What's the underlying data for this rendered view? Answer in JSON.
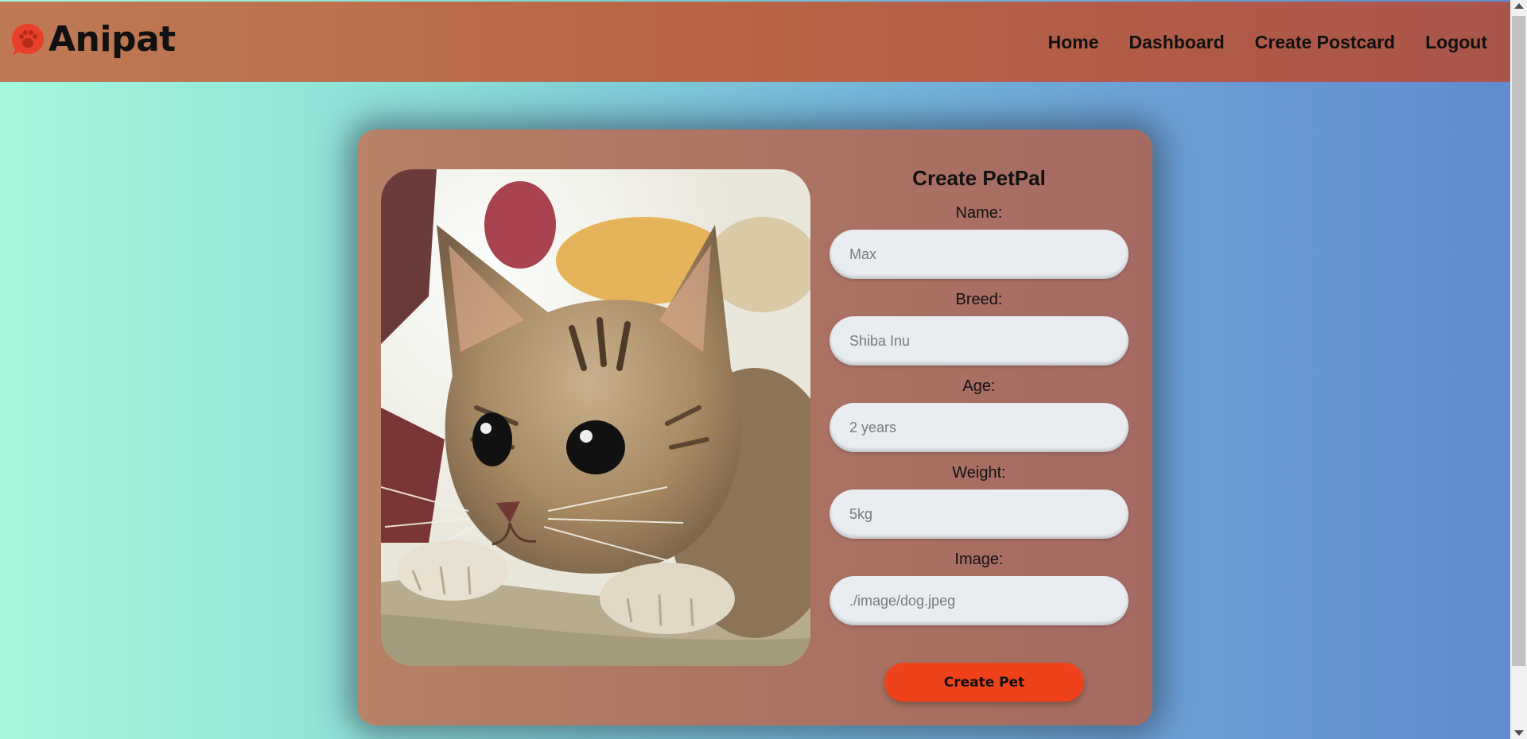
{
  "brand": {
    "name": "Anipat",
    "logo_icon": "paw-speech-bubble-icon",
    "accent": "#e8402a"
  },
  "nav": {
    "items": [
      {
        "label": "Home"
      },
      {
        "label": "Dashboard"
      },
      {
        "label": "Create Postcard"
      },
      {
        "label": "Logout"
      }
    ]
  },
  "form": {
    "title": "Create PetPal",
    "fields": [
      {
        "label": "Name:",
        "placeholder": "Max"
      },
      {
        "label": "Breed:",
        "placeholder": "Shiba Inu"
      },
      {
        "label": "Age:",
        "placeholder": "2 years"
      },
      {
        "label": "Weight:",
        "placeholder": "5kg"
      },
      {
        "label": "Image:",
        "placeholder": "./image/dog.jpeg"
      }
    ],
    "submit_label": "Create Pet",
    "submit_color": "#f0421a"
  },
  "preview": {
    "image": "kitten-photo"
  }
}
